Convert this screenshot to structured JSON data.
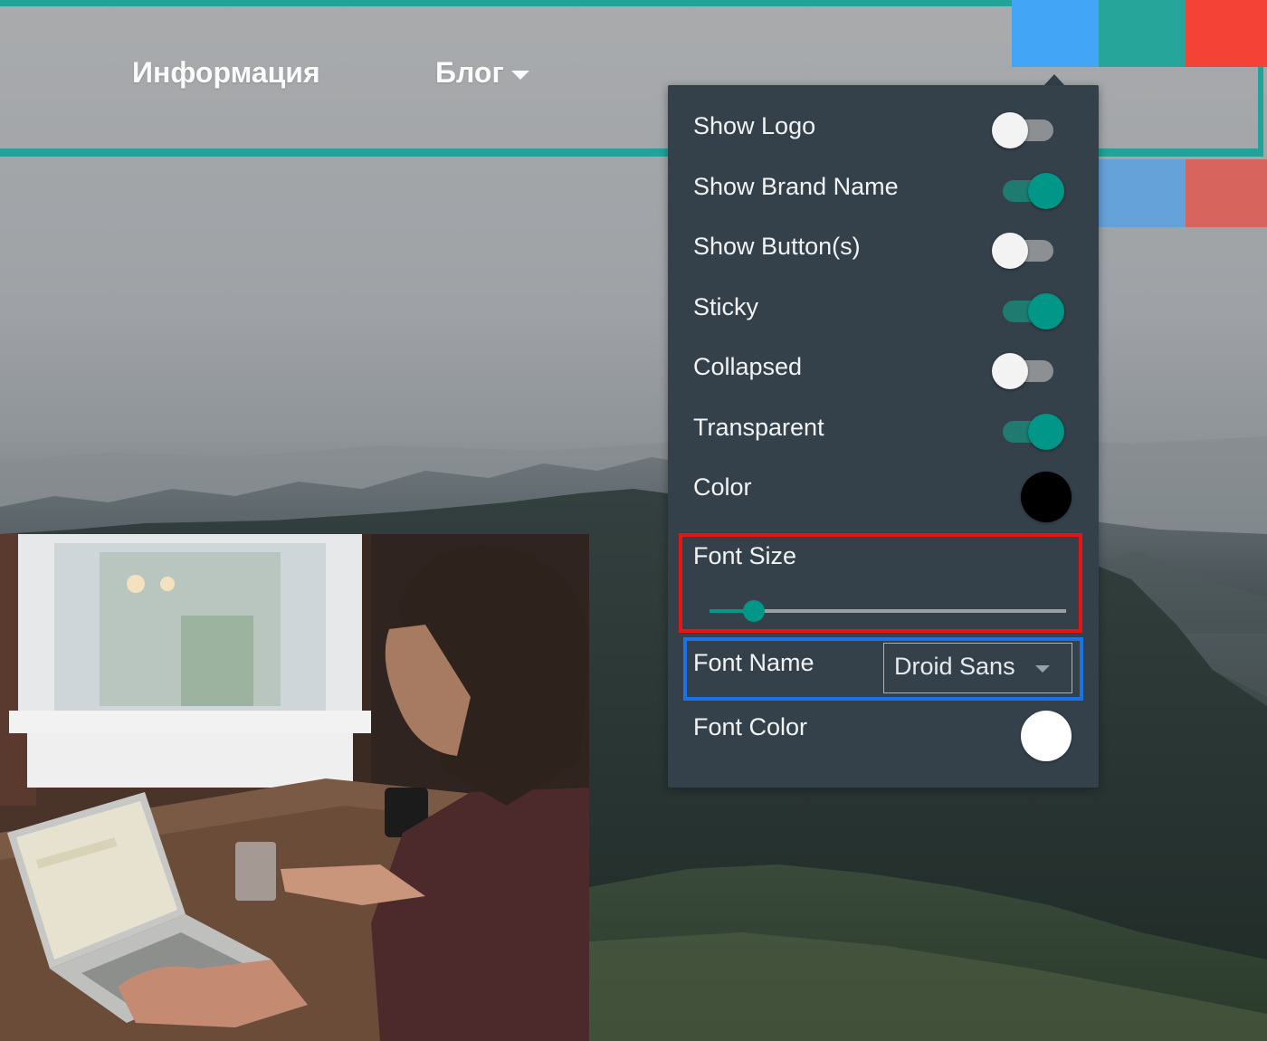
{
  "nav": {
    "links": [
      {
        "label": "Информация"
      },
      {
        "label": "Блог"
      }
    ]
  },
  "swatches": {
    "colors": [
      "#42a5f5",
      "#26a69a",
      "#f44336",
      "#64a2d9",
      "#d7645d"
    ]
  },
  "panel": {
    "toggles": [
      {
        "label": "Show Logo",
        "on": false
      },
      {
        "label": "Show Brand Name",
        "on": true
      },
      {
        "label": "Show Button(s)",
        "on": false
      },
      {
        "label": "Sticky",
        "on": true
      },
      {
        "label": "Collapsed",
        "on": false
      },
      {
        "label": "Transparent",
        "on": true
      }
    ],
    "color": {
      "label": "Color",
      "value": "#000000"
    },
    "font_size": {
      "label": "Font Size",
      "value_fraction": 0.125
    },
    "font_name": {
      "label": "Font Name",
      "value": "Droid Sans"
    },
    "font_color": {
      "label": "Font Color",
      "value": "#ffffff"
    }
  },
  "theme": {
    "accent": "#009688",
    "navbar_border": "#21a39a",
    "panel_bg": "#34404a",
    "highlight_red": "#ee1111",
    "highlight_blue": "#1a73e8"
  },
  "icons": {
    "nav_caret": "chevron-down-icon",
    "select_caret": "chevron-down-icon"
  }
}
